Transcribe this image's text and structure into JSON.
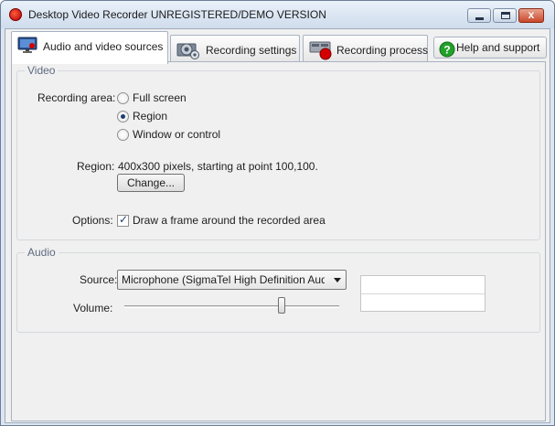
{
  "window": {
    "title": "Desktop Video Recorder UNREGISTERED/DEMO VERSION",
    "buttons": {
      "minimize": "minimize",
      "maximize": "maximize",
      "close": "x"
    }
  },
  "tabs": [
    {
      "label": "Audio and video sources",
      "icon": "monitor-icon",
      "active": true
    },
    {
      "label": "Recording settings",
      "icon": "gear-icon",
      "active": false
    },
    {
      "label": "Recording process",
      "icon": "record-icon",
      "active": false
    },
    {
      "label": "Help and support",
      "icon": "help-icon",
      "active": false
    }
  ],
  "video": {
    "legend": "Video",
    "recording_area_label": "Recording area:",
    "options": [
      "Full screen",
      "Region",
      "Window or control"
    ],
    "selected": "Region",
    "region_label": "Region:",
    "region_value": "400x300 pixels, starting at point 100,100.",
    "change_button": "Change...",
    "options_label": "Options:",
    "frame_checkbox": {
      "label": "Draw a frame around the recorded area",
      "checked": true
    }
  },
  "audio": {
    "legend": "Audio",
    "source_label": "Source:",
    "source_value": "Microphone (SigmaTel High Definition Audio",
    "volume_label": "Volume:",
    "volume_level": 0.73
  },
  "colors": {
    "accent": "#1c3f6e",
    "record_red": "#d40000",
    "help_green": "#22a02a"
  }
}
